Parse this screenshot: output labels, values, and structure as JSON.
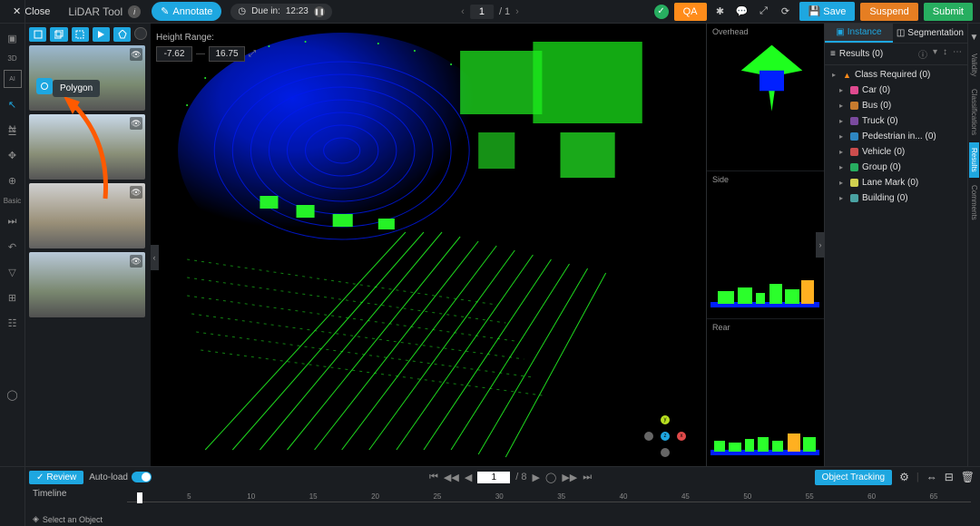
{
  "topbar": {
    "close": "Close",
    "tool_name": "LiDAR Tool",
    "annotate": "Annotate",
    "due_label": "Due in:",
    "due_time": "12:23",
    "page_current": "1",
    "page_total": "/ 1",
    "qa": "QA",
    "save": "Save",
    "suspend": "Suspend",
    "submit": "Submit"
  },
  "tooltip": {
    "polygon": "Polygon"
  },
  "viewer": {
    "height_range_label": "Height Range:",
    "height_min": "-7.62",
    "height_max": "16.75"
  },
  "sideviews": {
    "overhead": "Overhead",
    "side": "Side",
    "rear": "Rear"
  },
  "panel": {
    "tab_instance": "Instance",
    "tab_segmentation": "Segmentation",
    "results_label": "Results (0)",
    "nodes": [
      {
        "label": "Class Required  (0)",
        "warn": true
      },
      {
        "label": "Car  (0)",
        "color": "#e04a8f"
      },
      {
        "label": "Bus  (0)",
        "color": "#c77b2e"
      },
      {
        "label": "Truck  (0)",
        "color": "#7a4a9e"
      },
      {
        "label": "Pedestrian in...  (0)",
        "color": "#2e86c1"
      },
      {
        "label": "Vehicle  (0)",
        "color": "#cc4d4d"
      },
      {
        "label": "Group  (0)",
        "color": "#27ae60"
      },
      {
        "label": "Lane Mark  (0)",
        "color": "#d0d050"
      },
      {
        "label": "Building  (0)",
        "color": "#4aa3a3"
      }
    ]
  },
  "rightrail": {
    "validity": "Validity",
    "classifications": "Classifications",
    "results": "Results",
    "comments": "Comments"
  },
  "bottom": {
    "review": "Review",
    "autoload": "Auto-load",
    "frame_current": "1",
    "frame_total": "/ 8",
    "object_tracking": "Object Tracking",
    "timeline": "Timeline",
    "select_object": "Select an Object",
    "ticks": [
      5,
      10,
      15,
      20,
      25,
      30,
      35,
      40,
      45,
      50,
      55,
      60,
      65
    ]
  }
}
